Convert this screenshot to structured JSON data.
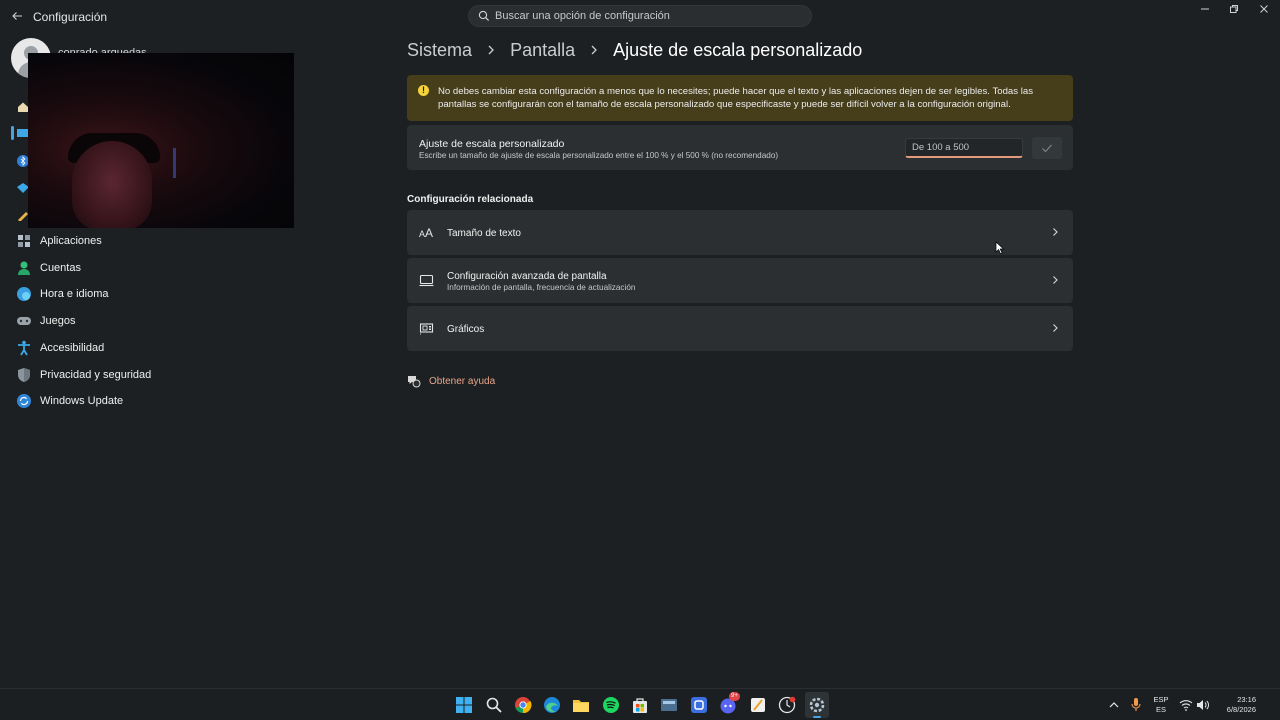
{
  "titlebar": {
    "app_title": "Configuración",
    "search_placeholder": "Buscar una opción de configuración"
  },
  "profile": {
    "name": "conrado arguedas"
  },
  "sidebar": {
    "items": [
      {
        "label": "Aplicaciones",
        "icon": "apps-icon"
      },
      {
        "label": "Cuentas",
        "icon": "accounts-icon"
      },
      {
        "label": "Hora e idioma",
        "icon": "time-language-icon"
      },
      {
        "label": "Juegos",
        "icon": "gamepad-icon"
      },
      {
        "label": "Accesibilidad",
        "icon": "accessibility-icon"
      },
      {
        "label": "Privacidad y seguridad",
        "icon": "shield-icon"
      },
      {
        "label": "Windows Update",
        "icon": "update-icon"
      }
    ]
  },
  "breadcrumb": {
    "items": [
      "Sistema",
      "Pantalla"
    ],
    "current": "Ajuste de escala personalizado"
  },
  "warning": {
    "text": "No debes cambiar esta configuración a menos que lo necesites; puede hacer que el texto y las aplicaciones dejen de ser legibles. Todas las pantallas se configurarán con el tamaño de escala personalizado que especificaste y puede ser difícil volver a la configuración original."
  },
  "custom_scale": {
    "title": "Ajuste de escala personalizado",
    "subtitle": "Escribe un tamaño de ajuste de escala personalizado entre el 100 % y el 500 % (no recomendado)",
    "input_placeholder": "De 100 a 500",
    "input_value": ""
  },
  "related": {
    "title": "Configuración relacionada",
    "items": [
      {
        "title": "Tamaño de texto",
        "subtitle": "",
        "icon": "text-size-icon"
      },
      {
        "title": "Configuración avanzada de pantalla",
        "subtitle": "Información de pantalla, frecuencia de actualización",
        "icon": "monitor-icon"
      },
      {
        "title": "Gráficos",
        "subtitle": "",
        "icon": "graphics-icon"
      }
    ]
  },
  "help": {
    "label": "Obtener ayuda"
  },
  "taskbar": {
    "language": "ESP",
    "language_sub": "ES",
    "time": "23:16",
    "date": "6/8/2026",
    "discord_badge": "9+"
  },
  "colors": {
    "accent": "#4aa3df",
    "warning_bg": "#463d1b",
    "warning_icon": "#f5d33a",
    "link": "#e8a58a",
    "input_underline": "#e39a7a"
  }
}
